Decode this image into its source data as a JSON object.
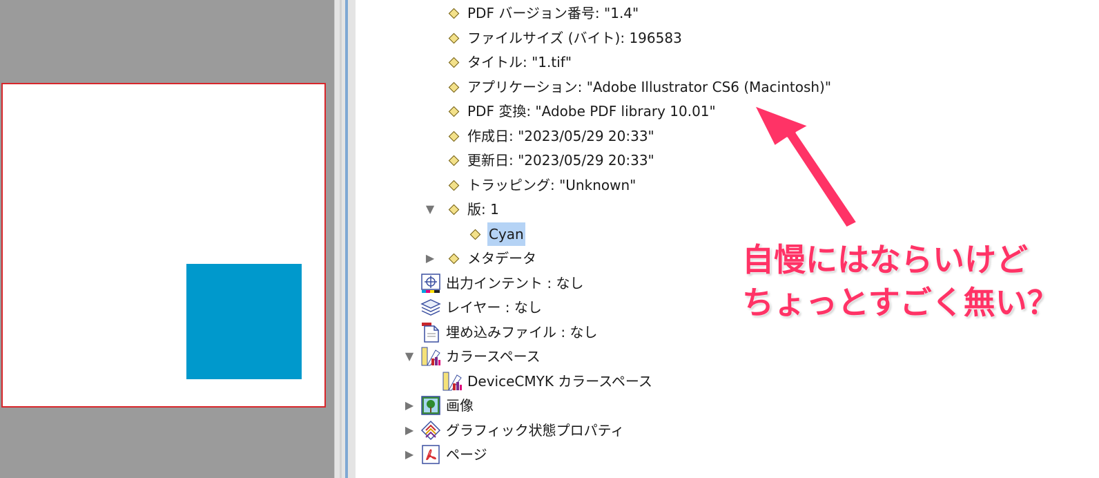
{
  "tree": {
    "pdf_info": [
      {
        "label": "PDF バージョン番号: \"1.4\""
      },
      {
        "label": "ファイルサイズ (バイト): 196583"
      },
      {
        "label": "タイトル: \"1.tif\""
      },
      {
        "label": "アプリケーション: \"Adobe Illustrator CS6 (Macintosh)\""
      },
      {
        "label": "PDF 変換: \"Adobe PDF library 10.01\""
      },
      {
        "label": "作成日: \"2023/05/29 20:33\""
      },
      {
        "label": "更新日: \"2023/05/29 20:33\""
      },
      {
        "label": "トラッピング: \"Unknown\""
      }
    ],
    "plates_label": "版: 1",
    "plate_item": "Cyan",
    "metadata_label": "メタデータ",
    "output_intent": "出力インテント : なし",
    "layers": "レイヤー : なし",
    "embedded_files": "埋め込みファイル : なし",
    "color_space": "カラースペース",
    "color_space_child": "DeviceCMYK カラースペース",
    "images": "画像",
    "graphics_state": "グラフィック状態プロパティ",
    "pages": "ページ"
  },
  "annotation": {
    "line1": "自慢にはならいけど",
    "line2": "ちょっとすごく無い？"
  },
  "colors": {
    "cyan_swatch": "#0099cc",
    "annotation": "#ff3366",
    "selection": "#b5d3f5"
  }
}
